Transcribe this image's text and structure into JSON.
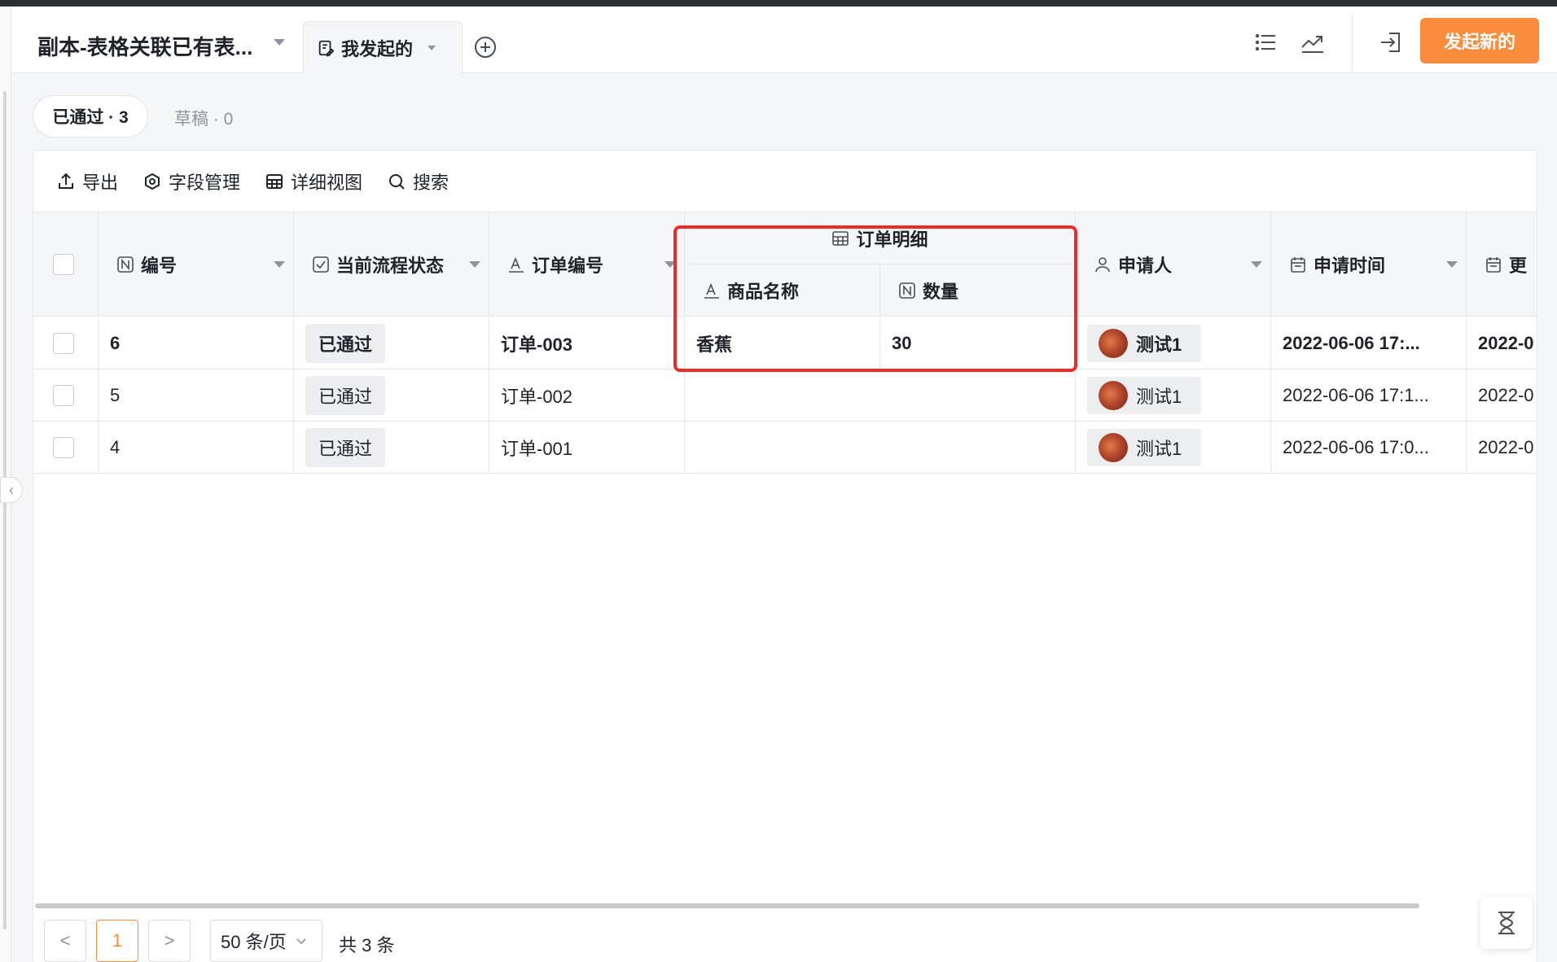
{
  "header": {
    "app_title": "副本-表格关联已有表...",
    "view_tab_label": "我发起的",
    "primary_button": "发起新的"
  },
  "status_tabs": {
    "approved": "已通过 · 3",
    "draft": "草稿 · 0"
  },
  "toolbar": {
    "export": "导出",
    "field_manage": "字段管理",
    "detail_view": "详细视图",
    "search": "搜索"
  },
  "columns": {
    "number": "编号",
    "flow_status": "当前流程状态",
    "order_no": "订单编号",
    "group": "订单明细",
    "product_name": "商品名称",
    "quantity": "数量",
    "applicant": "申请人",
    "apply_time": "申请时间",
    "more": "更"
  },
  "rows": [
    {
      "number": "6",
      "status": "已通过",
      "order_no": "订单-003",
      "product": "香蕉",
      "quantity": "30",
      "applicant": "测试1",
      "apply_time": "2022-06-06 17:...",
      "more": "2022-0"
    },
    {
      "number": "5",
      "status": "已通过",
      "order_no": "订单-002",
      "product": "",
      "quantity": "",
      "applicant": "测试1",
      "apply_time": "2022-06-06 17:1...",
      "more": "2022-0"
    },
    {
      "number": "4",
      "status": "已通过",
      "order_no": "订单-001",
      "product": "",
      "quantity": "",
      "applicant": "测试1",
      "apply_time": "2022-06-06 17:0...",
      "more": "2022-0"
    }
  ],
  "pagination": {
    "prev": "<",
    "current_page": "1",
    "next": ">",
    "page_size": "50 条/页",
    "total": "共 3 条"
  },
  "colors": {
    "primary": "#f98d3b",
    "highlight": "#ee2b2b"
  }
}
